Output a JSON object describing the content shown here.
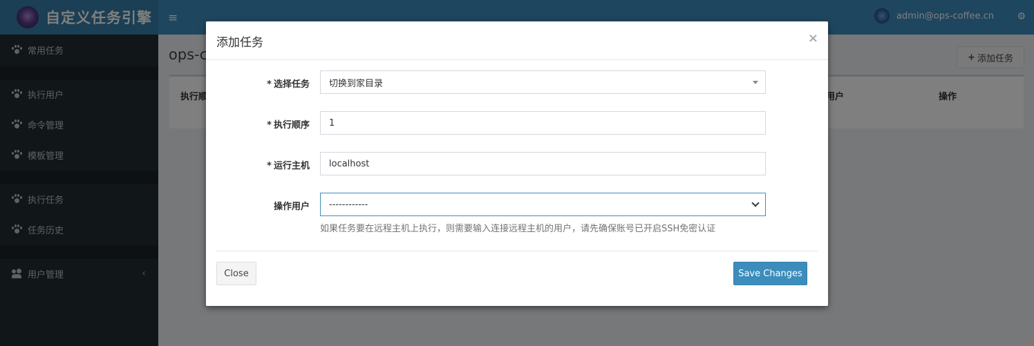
{
  "app": {
    "brand_title": "自定义任务引擎",
    "user_email": "admin@ops-coffee.cn"
  },
  "sidebar": {
    "items": [
      {
        "label": "常用任务",
        "icon": "paw-icon"
      },
      {
        "label": "执行用户",
        "icon": "paw-icon"
      },
      {
        "label": "命令管理",
        "icon": "paw-icon"
      },
      {
        "label": "模板管理",
        "icon": "paw-icon"
      },
      {
        "label": "执行任务",
        "icon": "paw-icon"
      },
      {
        "label": "任务历史",
        "icon": "paw-icon"
      },
      {
        "label": "用户管理",
        "icon": "users-icon"
      }
    ]
  },
  "content": {
    "title": "ops-c",
    "add_button_label": "添加任务",
    "table_headers": [
      "执行顺",
      "用户",
      "操作"
    ]
  },
  "modal": {
    "title": "添加任务",
    "close_glyph": "×",
    "fields": {
      "task": {
        "label": "选择任务",
        "required_mark": "*",
        "value": "切换到家目录"
      },
      "order": {
        "label": "执行顺序",
        "required_mark": "*",
        "value": "1"
      },
      "host": {
        "label": "运行主机",
        "required_mark": "*",
        "value": "localhost"
      },
      "user": {
        "label": "操作用户",
        "value": "------------"
      }
    },
    "help_text": "如果任务要在远程主机上执行，则需要输入连接远程主机的用户，请先确保账号已开启SSH免密认证",
    "close_button": "Close",
    "save_button": "Save Changes"
  },
  "colors": {
    "header_blue": "#3c8dbc",
    "sidebar_dark": "#222d32",
    "primary_button": "#3c8dbc"
  }
}
